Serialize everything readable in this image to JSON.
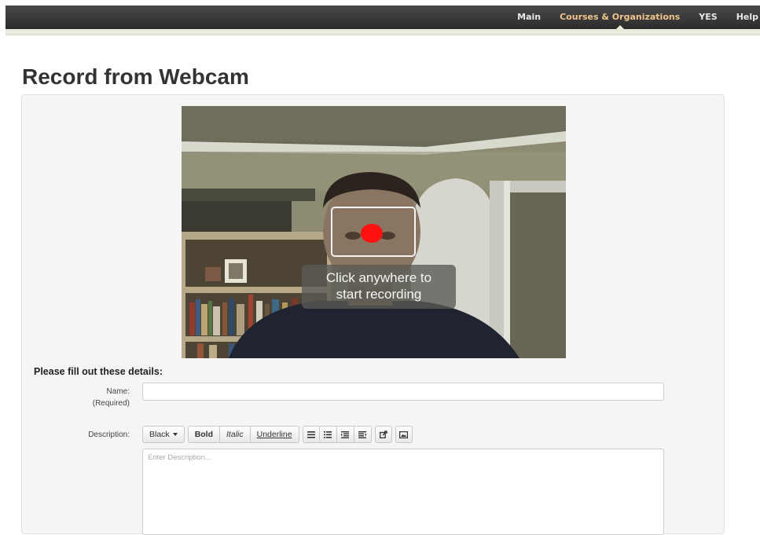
{
  "nav": {
    "items": [
      {
        "label": "Main",
        "active": false
      },
      {
        "label": "Courses & Organizations",
        "active": true
      },
      {
        "label": "YES",
        "active": false
      },
      {
        "label": "Help",
        "active": false
      }
    ]
  },
  "page": {
    "title": "Record from Webcam"
  },
  "webcam": {
    "prompt_line1": "Click anywhere to",
    "prompt_line2": "start recording",
    "record_indicator_color": "#ff1010"
  },
  "form": {
    "heading": "Please fill out these details:",
    "name_label": "Name:",
    "name_required": "(Required)",
    "name_value": "",
    "description_label": "Description:",
    "description_placeholder": "Enter Description...",
    "description_value": ""
  },
  "toolbar": {
    "color_label": "Black",
    "bold_label": "Bold",
    "italic_label": "Italic",
    "underline_label": "Underline",
    "list_icons": [
      "unordered-list-icon",
      "ordered-list-icon",
      "outdent-icon",
      "indent-icon"
    ],
    "link_icon": "link-icon",
    "image_icon": "image-icon"
  },
  "colors": {
    "nav_active": "#f0c48c",
    "nav_bg": "#2b2b2b",
    "panel_bg": "#f5f5f5"
  }
}
